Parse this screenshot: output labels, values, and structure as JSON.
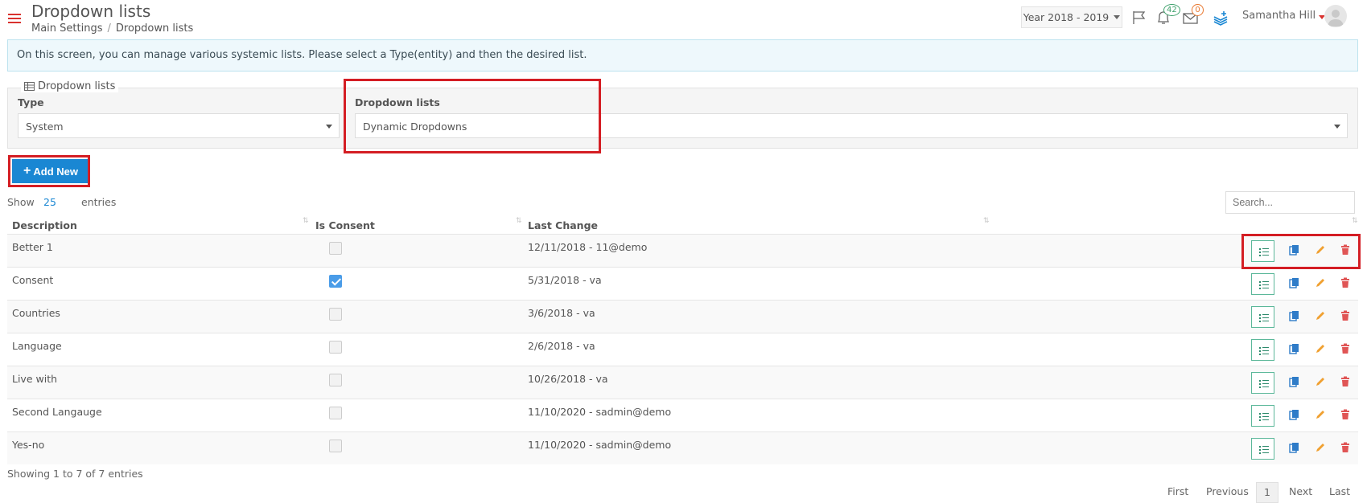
{
  "header": {
    "title": "Dropdown lists",
    "breadcrumb": [
      "Main Settings",
      "Dropdown lists"
    ],
    "year": "Year 2018 - 2019",
    "notifications_count": "42",
    "messages_count": "0",
    "user_name": "Samantha Hill"
  },
  "info": "On this screen, you can manage various systemic lists. Please select a Type(entity) and then the desired list.",
  "filter": {
    "legend": "Dropdown lists",
    "type_label": "Type",
    "type_value": "System",
    "list_label": "Dropdown lists",
    "list_value": "Dynamic Dropdowns"
  },
  "add_button": "Add New",
  "entries": {
    "show": "Show",
    "count": "25",
    "suffix": "entries",
    "search_placeholder": "Search..."
  },
  "table": {
    "columns": [
      "Description",
      "Is Consent",
      "Last Change"
    ],
    "rows": [
      {
        "description": "Better 1",
        "consent": false,
        "last_change": "12/11/2018 - 11@demo"
      },
      {
        "description": "Consent",
        "consent": true,
        "last_change": "5/31/2018 - va"
      },
      {
        "description": "Countries",
        "consent": false,
        "last_change": "3/6/2018 - va"
      },
      {
        "description": "Language",
        "consent": false,
        "last_change": "2/6/2018 - va"
      },
      {
        "description": "Live with",
        "consent": false,
        "last_change": "10/26/2018 - va"
      },
      {
        "description": "Second Langauge",
        "consent": false,
        "last_change": "11/10/2020 - sadmin@demo"
      },
      {
        "description": "Yes-no",
        "consent": false,
        "last_change": "11/10/2020 - sadmin@demo"
      }
    ]
  },
  "footer": {
    "summary": "Showing 1 to 7 of 7 entries",
    "pagination": {
      "first": "First",
      "previous": "Previous",
      "current": "1",
      "next": "Next",
      "last": "Last"
    }
  },
  "colors": {
    "accent": "#1a87d3",
    "highlight": "#d41e24",
    "edit": "#f0a030",
    "delete": "#e05555",
    "list": "#2d8a6c"
  }
}
